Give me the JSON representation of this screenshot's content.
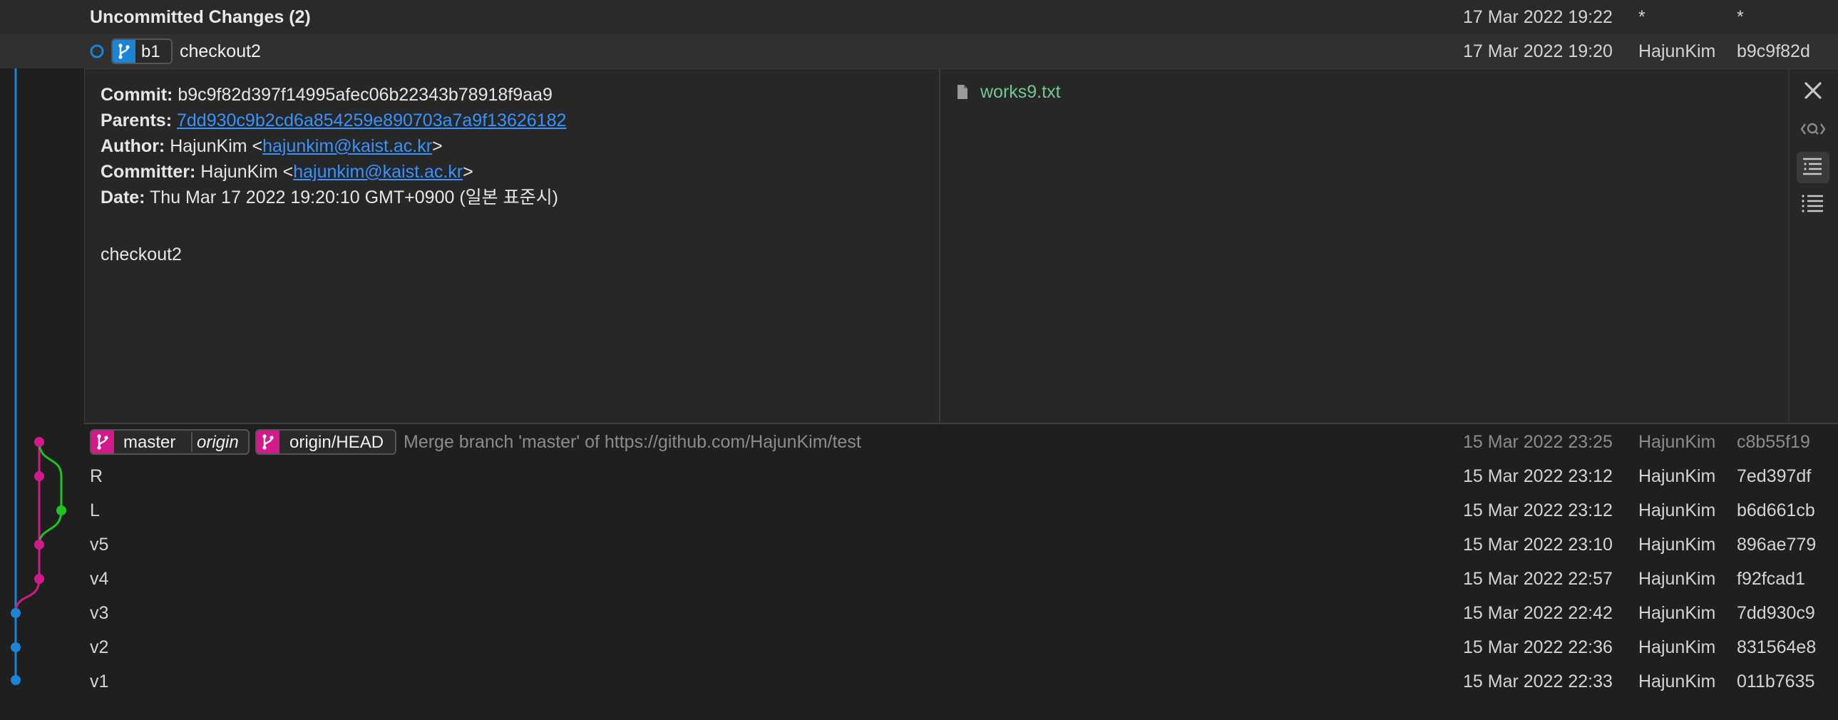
{
  "uncommitted": {
    "message": "Uncommitted Changes (2)",
    "date": "17 Mar 2022 19:22",
    "author": "*",
    "hash": "*"
  },
  "selected_commit": {
    "branch": "b1",
    "message": "checkout2",
    "date": "17 Mar 2022 19:20",
    "author": "HajunKim",
    "hash": "b9c9f82d"
  },
  "details": {
    "commit_label": "Commit:",
    "commit_value": "b9c9f82d397f14995afec06b22343b78918f9aa9",
    "parents_label": "Parents:",
    "parents_value": "7dd930c9b2cd6a854259e890703a7a9f13626182",
    "author_label": "Author:",
    "author_name": "HajunKim <",
    "author_email": "hajunkim@kaist.ac.kr",
    "author_close": ">",
    "committer_label": "Committer:",
    "committer_name": "HajunKim <",
    "committer_email": "hajunkim@kaist.ac.kr",
    "committer_close": ">",
    "date_label": "Date:",
    "date_value": "Thu Mar 17 2022 19:20:10 GMT+0900 (일본 표준시)",
    "body": "checkout2",
    "files": [
      {
        "name": "works9.txt",
        "icon": "file-icon"
      }
    ]
  },
  "sidebar_icons": [
    "close-icon",
    "search-diff-icon",
    "tree-view-icon",
    "list-view-icon"
  ],
  "refs": {
    "master": "master",
    "origin": "origin",
    "origin_head": "origin/HEAD"
  },
  "commits": [
    {
      "message": "Merge branch 'master' of https://github.com/HajunKim/test",
      "date": "15 Mar 2022 23:25",
      "author": "HajunKim",
      "hash": "c8b55f19"
    },
    {
      "message": "R",
      "date": "15 Mar 2022 23:12",
      "author": "HajunKim",
      "hash": "7ed397df"
    },
    {
      "message": "L",
      "date": "15 Mar 2022 23:12",
      "author": "HajunKim",
      "hash": "b6d661cb"
    },
    {
      "message": "v5",
      "date": "15 Mar 2022 23:10",
      "author": "HajunKim",
      "hash": "896ae779"
    },
    {
      "message": "v4",
      "date": "15 Mar 2022 22:57",
      "author": "HajunKim",
      "hash": "f92fcad1"
    },
    {
      "message": "v3",
      "date": "15 Mar 2022 22:42",
      "author": "HajunKim",
      "hash": "7dd930c9"
    },
    {
      "message": "v2",
      "date": "15 Mar 2022 22:36",
      "author": "HajunKim",
      "hash": "831564e8"
    },
    {
      "message": "v1",
      "date": "15 Mar 2022 22:33",
      "author": "HajunKim",
      "hash": "011b7635"
    }
  ],
  "colors": {
    "blue": "#1a85d6",
    "magenta": "#d4198a",
    "green": "#1fc41f",
    "grey": "#8a8a8a",
    "link": "#3794ff",
    "file": "#73c991"
  }
}
